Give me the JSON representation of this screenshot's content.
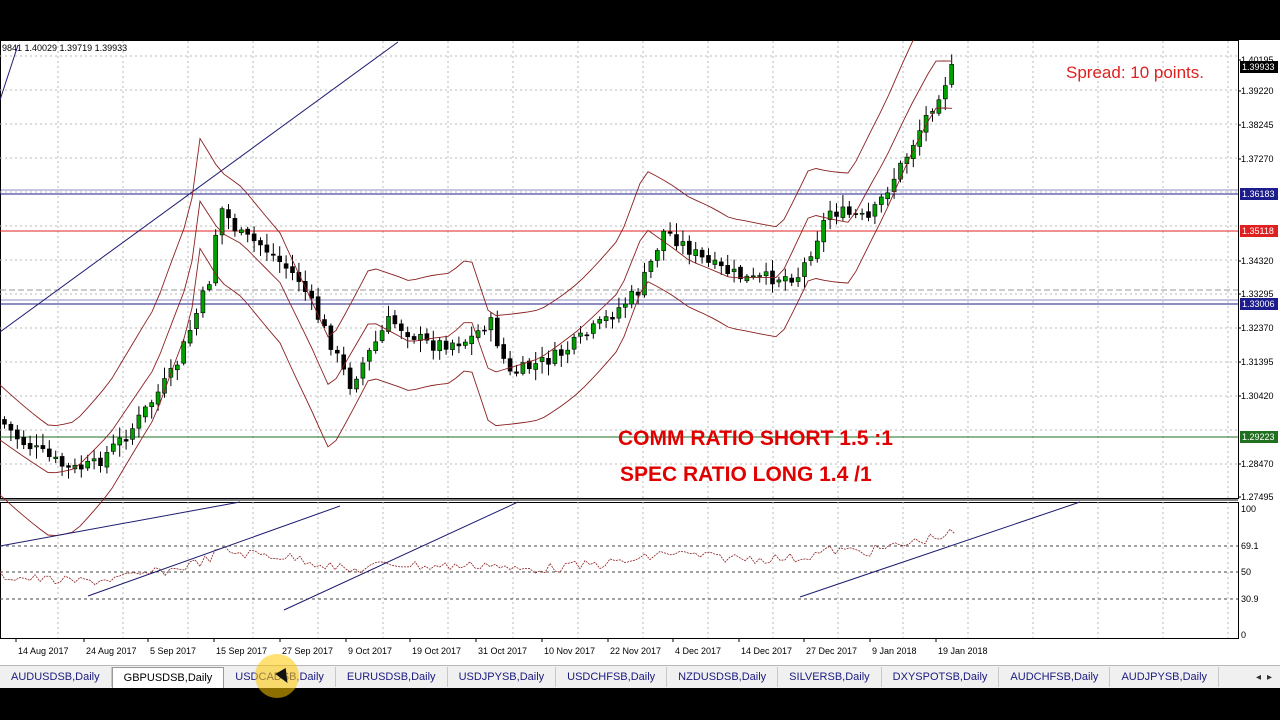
{
  "window": {
    "ohlc_readout": "9841 1.40029 1.39719 1.39933",
    "spread_text": "Spread: 10 points.",
    "annotation_line1": "COMM RATIO SHORT 1.5 :1",
    "annotation_line2": "SPEC RATIO LONG 1.4 /1"
  },
  "colors": {
    "bull": "#00a000",
    "bear": "#000000",
    "bands": "#8b2020",
    "trendline": "#1c1c70",
    "spread": "#e02020",
    "annotation": "#e00000",
    "hline_blue": "#1c1c8c",
    "hline_red": "#e02020",
    "hline_green": "#207020"
  },
  "price_axis": {
    "ticks": [
      "1.40195",
      "1.39220",
      "1.38245",
      "1.37270",
      "1.34320",
      "1.33295",
      "1.32370",
      "1.31395",
      "1.30420",
      "1.28470",
      "1.27495"
    ],
    "tagged_levels": [
      {
        "label": "1.39933",
        "style": "black"
      },
      {
        "label": "1.36183",
        "style": "blue"
      },
      {
        "label": "1.35118",
        "style": "red"
      },
      {
        "label": "1.33006",
        "style": "blue"
      },
      {
        "label": "1.29223",
        "style": "green"
      }
    ]
  },
  "indicator_axis": {
    "ticks": [
      "100",
      "69.1",
      "50",
      "30.9",
      "0"
    ]
  },
  "time_axis": {
    "ticks": [
      "14 Aug 2017",
      "24 Aug 2017",
      "5 Sep 2017",
      "15 Sep 2017",
      "27 Sep 2017",
      "9 Oct 2017",
      "19 Oct 2017",
      "31 Oct 2017",
      "10 Nov 2017",
      "22 Nov 2017",
      "4 Dec 2017",
      "14 Dec 2017",
      "27 Dec 2017",
      "9 Jan 2018",
      "19 Jan 2018"
    ]
  },
  "tabs": [
    {
      "label": "AUDUSDSB,Daily",
      "active": false
    },
    {
      "label": "GBPUSDSB,Daily",
      "active": true
    },
    {
      "label": "USDCADSB,Daily",
      "active": false
    },
    {
      "label": "EURUSDSB,Daily",
      "active": false
    },
    {
      "label": "USDJPYSB,Daily",
      "active": false
    },
    {
      "label": "USDCHFSB,Daily",
      "active": false
    },
    {
      "label": "NZDUSDSB,Daily",
      "active": false
    },
    {
      "label": "SILVERSB,Daily",
      "active": false
    },
    {
      "label": "DXYSPOTSB,Daily",
      "active": false
    },
    {
      "label": "AUDCHFSB,Daily",
      "active": false
    },
    {
      "label": "AUDJPYSB,Daily",
      "active": false
    }
  ],
  "tab_nav": {
    "prev": "◂",
    "next": "▸"
  },
  "icons": {
    "tab_prev": "chevron-left-icon",
    "tab_next": "chevron-right-icon"
  }
}
